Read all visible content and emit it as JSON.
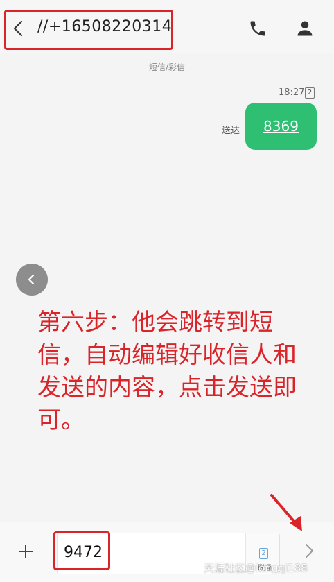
{
  "header": {
    "contact_number": "//+16508220314",
    "back_icon": "back-chevron-icon",
    "phone_icon": "phone-icon",
    "contact_icon": "person-icon"
  },
  "conversation": {
    "divider_label": "短信/彩信",
    "message": {
      "time": "18:27",
      "sim_slot": "2",
      "status": "送达",
      "text": "8369"
    }
  },
  "annotation": {
    "text": "第六步：他会跳转到短信，自动编辑好收信人和发送的内容，点击发送即可。"
  },
  "compose": {
    "input_value": "9472",
    "sim_slot": "2",
    "sim_label": "联通",
    "add_icon": "plus-icon",
    "send_icon": "send-chevron-icon"
  },
  "watermark": "天涯社区@longqi188",
  "colors": {
    "bubble": "#2fbf73",
    "annotation": "#d9242a",
    "background": "#f4f4f4"
  }
}
